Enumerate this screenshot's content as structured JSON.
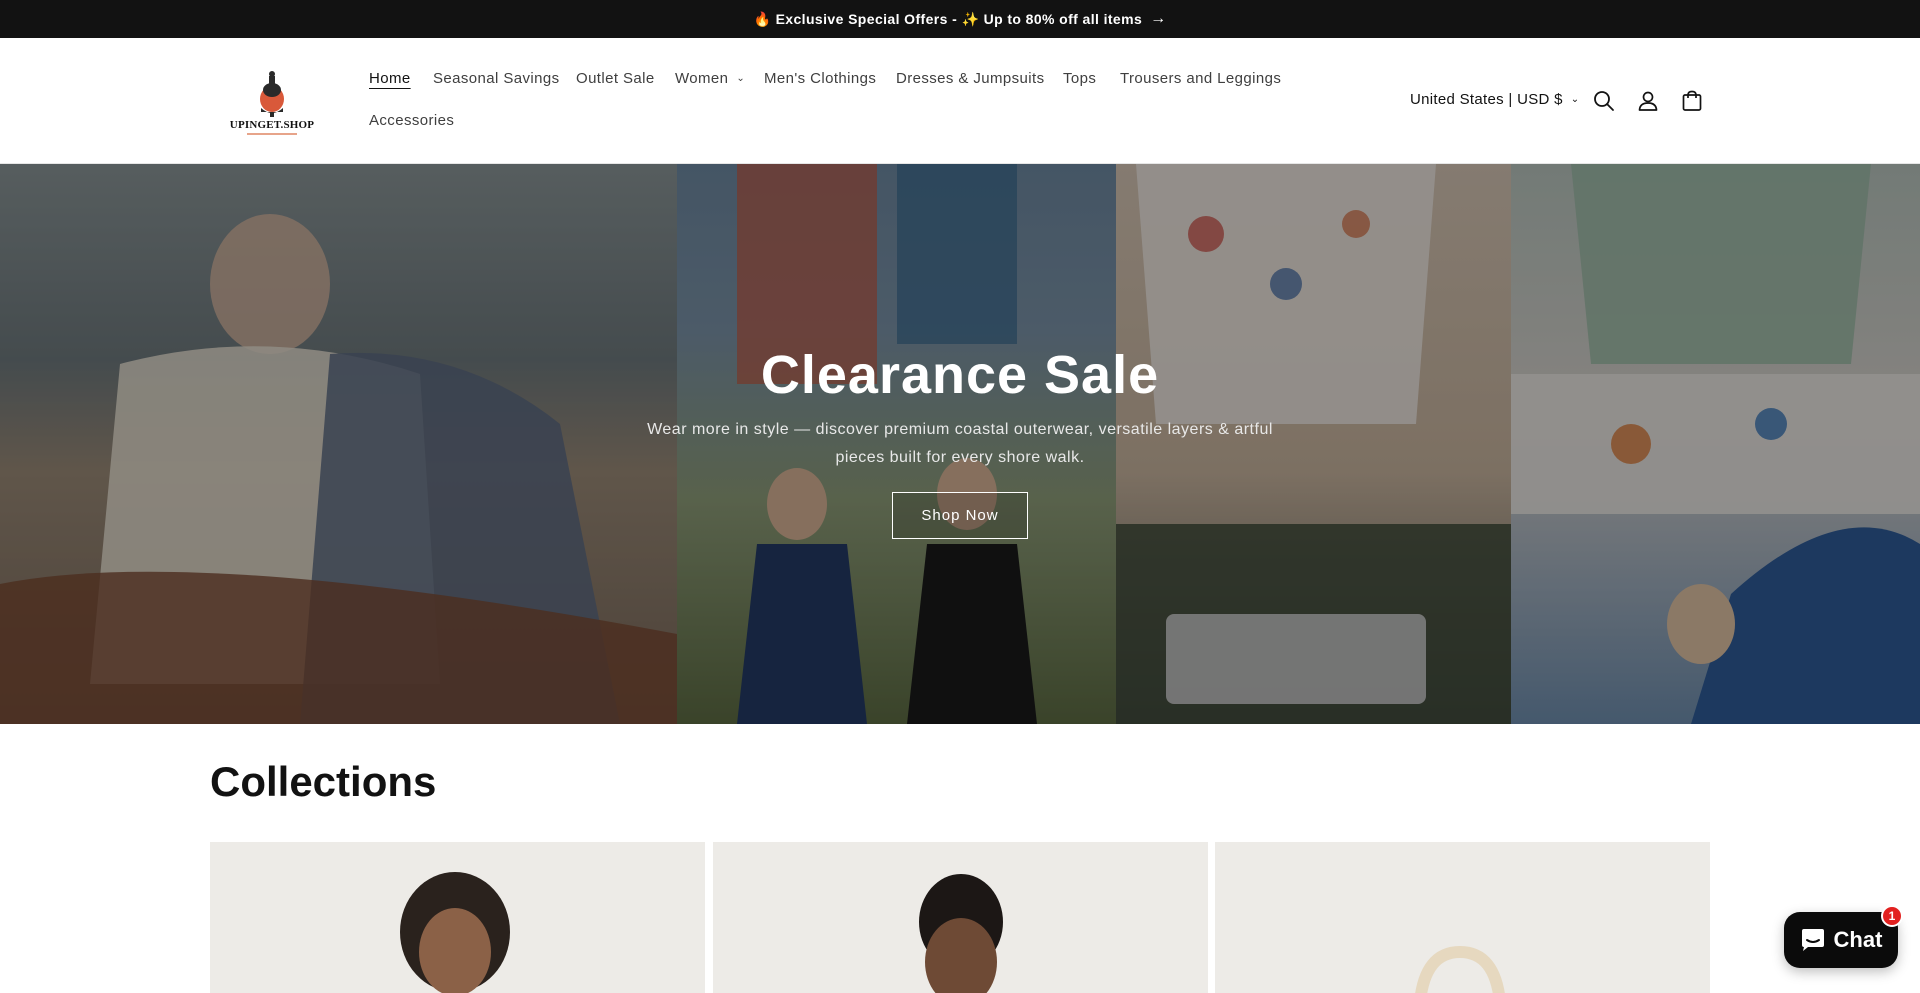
{
  "announcement": {
    "text": "🔥 Exclusive Special Offers - ✨ Up to 80% off all items",
    "arrow": "→"
  },
  "header": {
    "logo_text": "UPINGET.SHOP",
    "nav": [
      {
        "label": "Home",
        "active": true
      },
      {
        "label": "Seasonal Savings"
      },
      {
        "label": "Outlet Sale"
      },
      {
        "label": "Women",
        "has_dropdown": true
      },
      {
        "label": "Men's Clothings"
      },
      {
        "label": "Dresses & Jumpsuits"
      },
      {
        "label": "Tops"
      },
      {
        "label": "Trousers and Leggings"
      },
      {
        "label": "Accessories"
      }
    ],
    "country_selector": "United States | USD $",
    "icons": [
      "search-icon",
      "account-icon",
      "cart-icon"
    ]
  },
  "hero": {
    "title": "Clearance Sale",
    "subtitle": "Wear more in style — discover premium coastal outerwear, versatile layers & artful pieces built for every shore walk.",
    "button_label": "Shop Now"
  },
  "collections": {
    "title": "Collections"
  },
  "chat": {
    "label": "Chat",
    "badge": "1"
  },
  "colors": {
    "announcement_bg": "#121212",
    "chat_badge": "#e22120"
  }
}
